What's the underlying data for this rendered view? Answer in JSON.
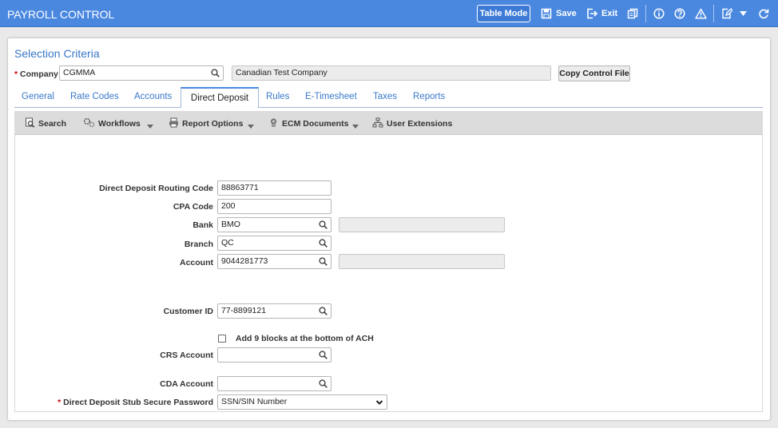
{
  "header": {
    "title": "PAYROLL CONTROL",
    "table_mode_label": "Table Mode",
    "save_label": "Save",
    "exit_label": "Exit",
    "accent_color": "#4a88e0"
  },
  "selection": {
    "title": "Selection Criteria",
    "company_label": "Company",
    "company_required": "*",
    "company_value": "CGMMA",
    "company_name": "Canadian Test Company",
    "copy_button_label": "Copy Control File"
  },
  "tabs": [
    {
      "label": "General"
    },
    {
      "label": "Rate Codes"
    },
    {
      "label": "Accounts"
    },
    {
      "label": "Direct Deposit",
      "active": true
    },
    {
      "label": "Rules"
    },
    {
      "label": "E-Timesheet"
    },
    {
      "label": "Taxes"
    },
    {
      "label": "Reports"
    }
  ],
  "toolbar": {
    "search_label": "Search",
    "workflows_label": "Workflows",
    "report_options_label": "Report Options",
    "ecm_documents_label": "ECM Documents",
    "user_extensions_label": "User Extensions"
  },
  "form": {
    "routing_code_label": "Direct Deposit Routing Code",
    "routing_code_value": "88863771",
    "cpa_code_label": "CPA Code",
    "cpa_code_value": "200",
    "bank_label": "Bank",
    "bank_value": "BMO",
    "bank_desc": "",
    "branch_label": "Branch",
    "branch_value": "QC",
    "account_label": "Account",
    "account_value": "9044281773",
    "account_desc": "",
    "customer_id_label": "Customer ID",
    "customer_id_value": "77-8899121",
    "add_blocks_label": "Add 9 blocks at the bottom of ACH",
    "add_blocks_checked": false,
    "crs_account_label": "CRS Account",
    "crs_account_value": "",
    "cda_account_label": "CDA Account",
    "cda_account_value": "",
    "stub_password_label": "Direct Deposit Stub Secure Password",
    "stub_password_required": "*",
    "stub_password_value": "SSN/SIN Number"
  }
}
